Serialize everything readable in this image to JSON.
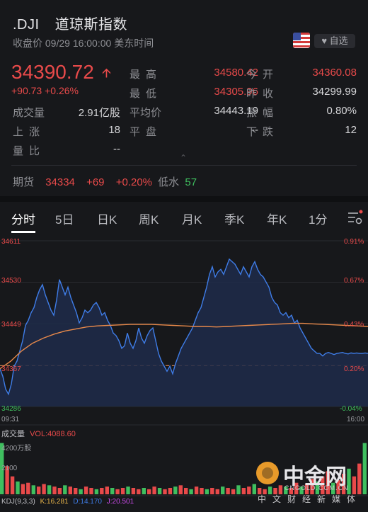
{
  "header": {
    "symbol": ".DJI",
    "name": "道琼斯指数",
    "close_label": "收盘价 09/29 16:00:00 美东时间",
    "watch_label": "自选",
    "watch_icon": "heart-icon"
  },
  "quote": {
    "price": "34390.72",
    "change": "+90.73",
    "change_pct": "+0.26%",
    "stats": [
      {
        "label": "最高",
        "value": "34580.42",
        "color": "red"
      },
      {
        "label": "今开",
        "value": "34360.08",
        "color": "red"
      },
      {
        "label": "最低",
        "value": "34305.96",
        "color": "red"
      },
      {
        "label": "昨收",
        "value": "34299.99",
        "color": "white"
      },
      {
        "label": "成交量",
        "value": "2.91亿股",
        "color": "white"
      },
      {
        "label": "平均价",
        "value": "34443.19",
        "color": "white"
      },
      {
        "label": "振幅",
        "value": "0.80%",
        "color": "white"
      },
      {
        "label": "上涨",
        "value": "18",
        "color": "white"
      },
      {
        "label": "平盘",
        "value": "--",
        "color": "white"
      },
      {
        "label": "下跌",
        "value": "12",
        "color": "white"
      },
      {
        "label": "量比",
        "value": "--",
        "color": "white"
      }
    ]
  },
  "futures": {
    "label": "期货",
    "price": "34334",
    "change": "+69",
    "change_pct": "+0.20%",
    "discount_label": "低水",
    "discount_value": "57"
  },
  "tabs": [
    "分时",
    "5日",
    "日K",
    "周K",
    "月K",
    "季K",
    "年K",
    "1分"
  ],
  "active_tab": 0,
  "chart_data": {
    "type": "line",
    "y_ticks": [
      "34611",
      "34530",
      "34449",
      "34367",
      "34286"
    ],
    "pct_ticks": [
      "0.91%",
      "0.67%",
      "0.43%",
      "0.20%",
      "-0.04%"
    ],
    "x_ticks": [
      "09:31",
      "16:00"
    ],
    "ylim": [
      34286,
      34611
    ],
    "prev_close": 34299.99,
    "series": [
      {
        "name": "price",
        "x": [
          0,
          3,
          6,
          9,
          12,
          15,
          18,
          21,
          24,
          27,
          30,
          33,
          36,
          39,
          42,
          45,
          48,
          51,
          54,
          57,
          60,
          63,
          66,
          69,
          72,
          75,
          78,
          81,
          84,
          87,
          90,
          93,
          96,
          99,
          102,
          105,
          108,
          111,
          114,
          117,
          120,
          123,
          126,
          129,
          132,
          135,
          138,
          141,
          144,
          147,
          150,
          153,
          156,
          159,
          162,
          165,
          168,
          171,
          174,
          177,
          180,
          183,
          186,
          189,
          192,
          195,
          198,
          201,
          204,
          207,
          210,
          213,
          216,
          219,
          222,
          225,
          228,
          231,
          234,
          237,
          240,
          243,
          246,
          249,
          252,
          255,
          258,
          261,
          264,
          267,
          270,
          273,
          276,
          279,
          282,
          285,
          288,
          291,
          294,
          297,
          300,
          303,
          306,
          309,
          312,
          315,
          318,
          321,
          324,
          327,
          330,
          333,
          336,
          339,
          342,
          345,
          348,
          351,
          354,
          357,
          360,
          363,
          366,
          369,
          372,
          375,
          378,
          381,
          384,
          387,
          390
        ],
        "values": [
          34360,
          34345,
          34320,
          34310,
          34330,
          34365,
          34375,
          34395,
          34415,
          34445,
          34455,
          34470,
          34480,
          34500,
          34515,
          34525,
          34505,
          34490,
          34475,
          34465,
          34495,
          34535,
          34520,
          34505,
          34520,
          34500,
          34485,
          34470,
          34450,
          34460,
          34475,
          34470,
          34475,
          34485,
          34490,
          34480,
          34465,
          34470,
          34455,
          34445,
          34430,
          34425,
          34415,
          34400,
          34405,
          34430,
          34410,
          34400,
          34415,
          34440,
          34420,
          34410,
          34425,
          34435,
          34440,
          34415,
          34390,
          34375,
          34365,
          34355,
          34365,
          34350,
          34370,
          34385,
          34400,
          34410,
          34420,
          34430,
          34440,
          34455,
          34470,
          34480,
          34500,
          34520,
          34545,
          34560,
          34540,
          34550,
          34555,
          34545,
          34560,
          34575,
          34570,
          34565,
          34555,
          34545,
          34560,
          34550,
          34540,
          34560,
          34570,
          34555,
          34545,
          34540,
          34530,
          34520,
          34500,
          34490,
          34485,
          34470,
          34465,
          34470,
          34460,
          34465,
          34450,
          34455,
          34440,
          34430,
          34420,
          34410,
          34400,
          34395,
          34390,
          34390,
          34385,
          34390,
          34392,
          34390,
          34388,
          34390,
          34391,
          34392,
          34390,
          34389,
          34391,
          34390,
          34391,
          34390,
          34390,
          34391,
          34390
        ]
      },
      {
        "name": "avg",
        "values": [
          34360,
          34375,
          34395,
          34410,
          34420,
          34428,
          34434,
          34438,
          34442,
          34444,
          34445,
          34446,
          34447,
          34447,
          34447,
          34446,
          34445,
          34444,
          34443,
          34443,
          34442,
          34443,
          34444,
          34445,
          34446,
          34447,
          34448,
          34449,
          34449,
          34448,
          34447,
          34446,
          34445,
          34444,
          34443
        ]
      }
    ],
    "volume": {
      "label": "成交量",
      "vol_text": "VOL:4088.60",
      "scale_top": "4200万股",
      "scale_mid": "2100"
    },
    "kdj": {
      "label": "KDJ(9,3,3)",
      "k": "K:16.281",
      "d": "D:14.170",
      "j": "J:20.501"
    }
  },
  "logo": {
    "brand": "中金网",
    "domain": "CNGOLD.COM.CN",
    "tagline": "中文财经新媒体"
  },
  "colors": {
    "up": "#e84a4a",
    "down": "#3fbf5f",
    "price_line": "#3f7de8",
    "avg_line": "#e8894a"
  }
}
